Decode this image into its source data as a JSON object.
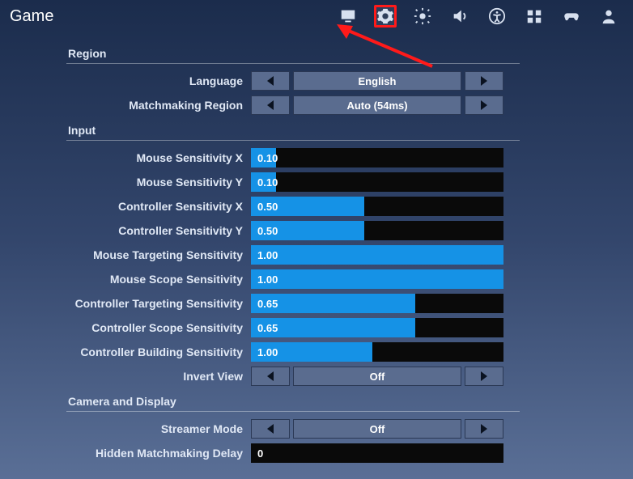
{
  "header": {
    "title": "Game"
  },
  "tabs": [
    {
      "name": "display-icon"
    },
    {
      "name": "gear-icon",
      "selected": true
    },
    {
      "name": "brightness-icon"
    },
    {
      "name": "audio-icon"
    },
    {
      "name": "accessibility-icon"
    },
    {
      "name": "input-bindings-icon"
    },
    {
      "name": "controller-icon"
    },
    {
      "name": "account-icon"
    }
  ],
  "sections": {
    "region": {
      "title": "Region",
      "language": {
        "label": "Language",
        "value": "English"
      },
      "matchmaking": {
        "label": "Matchmaking Region",
        "value": "Auto (54ms)"
      }
    },
    "input": {
      "title": "Input",
      "rows": [
        {
          "label": "Mouse Sensitivity X",
          "value": "0.10",
          "fill": 10
        },
        {
          "label": "Mouse Sensitivity Y",
          "value": "0.10",
          "fill": 10
        },
        {
          "label": "Controller Sensitivity X",
          "value": "0.50",
          "fill": 45
        },
        {
          "label": "Controller Sensitivity Y",
          "value": "0.50",
          "fill": 45
        },
        {
          "label": "Mouse Targeting Sensitivity",
          "value": "1.00",
          "fill": 100
        },
        {
          "label": "Mouse Scope Sensitivity",
          "value": "1.00",
          "fill": 100
        },
        {
          "label": "Controller Targeting Sensitivity",
          "value": "0.65",
          "fill": 65
        },
        {
          "label": "Controller Scope Sensitivity",
          "value": "0.65",
          "fill": 65
        },
        {
          "label": "Controller Building Sensitivity",
          "value": "1.00",
          "fill": 48
        }
      ],
      "invert": {
        "label": "Invert View",
        "value": "Off"
      }
    },
    "camera": {
      "title": "Camera and Display",
      "streamer": {
        "label": "Streamer Mode",
        "value": "Off"
      },
      "hiddenDelay": {
        "label": "Hidden Matchmaking Delay",
        "value": "0"
      }
    }
  }
}
